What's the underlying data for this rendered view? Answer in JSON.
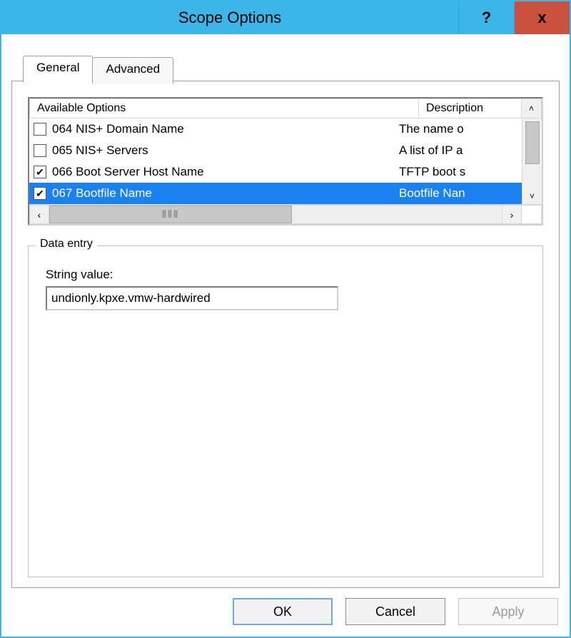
{
  "window": {
    "title": "Scope Options",
    "help_glyph": "?",
    "close_glyph": "x"
  },
  "tabs": [
    {
      "label": "General",
      "active": true
    },
    {
      "label": "Advanced",
      "active": false
    }
  ],
  "options_list": {
    "headers": {
      "options": "Available Options",
      "description": "Description"
    },
    "rows": [
      {
        "checked": false,
        "label": "064 NIS+ Domain Name",
        "description": "The name o",
        "selected": false
      },
      {
        "checked": false,
        "label": "065 NIS+ Servers",
        "description": "A list of IP a",
        "selected": false
      },
      {
        "checked": true,
        "label": "066 Boot Server Host Name",
        "description": "TFTP boot s",
        "selected": false
      },
      {
        "checked": true,
        "label": "067 Bootfile Name",
        "description": "Bootfile Nan",
        "selected": true
      }
    ],
    "hscroll_thumb_glyph": "⦀⦀⦀"
  },
  "data_entry": {
    "group_title": "Data entry",
    "string_label": "String value:",
    "string_value": "undionly.kpxe.vmw-hardwired"
  },
  "buttons": {
    "ok": "OK",
    "cancel": "Cancel",
    "apply": "Apply"
  }
}
